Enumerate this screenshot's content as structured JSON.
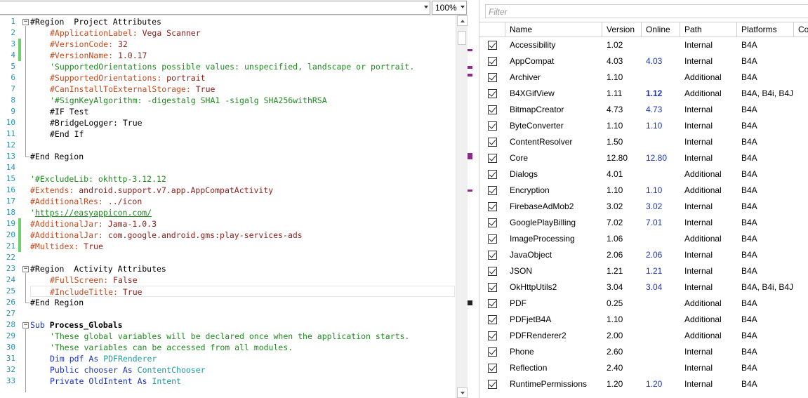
{
  "editor": {
    "module_selector": "",
    "zoom": "100%",
    "lines": [
      {
        "n": "1",
        "seg": [
          [
            "",
            "#Region  Project Attributes"
          ]
        ],
        "indent": false,
        "fold": "-",
        "changed": false
      },
      {
        "n": "2",
        "seg": [
          [
            "attr",
            "#ApplicationLabel: "
          ],
          [
            "str",
            "Vega Scanner"
          ]
        ],
        "indent": true,
        "changed": false
      },
      {
        "n": "3",
        "seg": [
          [
            "attr",
            "#VersionCode: "
          ],
          [
            "str",
            "32"
          ]
        ],
        "indent": true,
        "changed": true
      },
      {
        "n": "4",
        "seg": [
          [
            "attr",
            "#VersionName: "
          ],
          [
            "str",
            "1.0.17"
          ]
        ],
        "indent": true,
        "changed": true
      },
      {
        "n": "5",
        "seg": [
          [
            "cmt",
            "'SupportedOrientations possible values: unspecified, landscape or portrait."
          ]
        ],
        "indent": true,
        "changed": false
      },
      {
        "n": "6",
        "seg": [
          [
            "attr",
            "#SupportedOrientations: "
          ],
          [
            "str",
            "portrait"
          ]
        ],
        "indent": true,
        "changed": false
      },
      {
        "n": "7",
        "seg": [
          [
            "attr",
            "#CanInstallToExternalStorage: "
          ],
          [
            "str",
            "True"
          ]
        ],
        "indent": true,
        "changed": false
      },
      {
        "n": "8",
        "seg": [
          [
            "cmt",
            "'#SignKeyAlgorithm: -digestalg SHA1 -sigalg SHA256withRSA"
          ]
        ],
        "indent": true,
        "changed": false
      },
      {
        "n": "9",
        "seg": [
          [
            "",
            "#IF Test"
          ]
        ],
        "indent": true,
        "changed": false
      },
      {
        "n": "10",
        "seg": [
          [
            "",
            "#BridgeLogger: True"
          ]
        ],
        "indent": true,
        "changed": false
      },
      {
        "n": "11",
        "seg": [
          [
            "",
            "#End If"
          ]
        ],
        "indent": true,
        "changed": false
      },
      {
        "n": "12",
        "seg": [
          [
            "",
            ""
          ]
        ],
        "indent": false,
        "changed": false
      },
      {
        "n": "13",
        "seg": [
          [
            "",
            "#End Region"
          ]
        ],
        "indent": false,
        "changed": false
      },
      {
        "n": "14",
        "seg": [
          [
            "",
            ""
          ]
        ],
        "indent": false,
        "changed": false
      },
      {
        "n": "15",
        "seg": [
          [
            "cmt",
            "'#ExcludeLib: okhttp-3.12.12"
          ]
        ],
        "indent": false,
        "changed": false
      },
      {
        "n": "16",
        "seg": [
          [
            "attr",
            "#Extends: "
          ],
          [
            "str",
            "android.support.v7.app.AppCompatActivity"
          ]
        ],
        "indent": false,
        "changed": false
      },
      {
        "n": "17",
        "seg": [
          [
            "attr",
            "#AdditionalRes: "
          ],
          [
            "str",
            "../icon"
          ]
        ],
        "indent": false,
        "changed": false
      },
      {
        "n": "18",
        "seg": [
          [
            "cmt",
            "'"
          ],
          [
            "link",
            "https://easyappicon.com/"
          ]
        ],
        "indent": false,
        "changed": false
      },
      {
        "n": "19",
        "seg": [
          [
            "attr",
            "#AdditionalJar: "
          ],
          [
            "str",
            "Jama-1.0.3"
          ]
        ],
        "indent": false,
        "changed": true
      },
      {
        "n": "20",
        "seg": [
          [
            "attr",
            "#AdditionalJar: "
          ],
          [
            "str",
            "com.google.android.gms:play-services-ads"
          ]
        ],
        "indent": false,
        "changed": true
      },
      {
        "n": "21",
        "seg": [
          [
            "attr",
            "#Multidex: "
          ],
          [
            "str",
            "True"
          ]
        ],
        "indent": false,
        "changed": true
      },
      {
        "n": "22",
        "seg": [
          [
            "",
            ""
          ]
        ],
        "indent": false,
        "changed": false
      },
      {
        "n": "23",
        "seg": [
          [
            "",
            "#Region  Activity Attributes"
          ]
        ],
        "indent": false,
        "fold": "-",
        "changed": false
      },
      {
        "n": "24",
        "seg": [
          [
            "attr",
            "#FullScreen: "
          ],
          [
            "str",
            "False"
          ]
        ],
        "indent": true,
        "changed": false
      },
      {
        "n": "25",
        "seg": [
          [
            "attr",
            "#IncludeTitle: "
          ],
          [
            "str",
            "True"
          ]
        ],
        "indent": true,
        "changed": false,
        "current": true
      },
      {
        "n": "26",
        "seg": [
          [
            "",
            "#End Region"
          ]
        ],
        "indent": false,
        "changed": false
      },
      {
        "n": "27",
        "seg": [
          [
            "",
            ""
          ]
        ],
        "indent": false,
        "changed": false
      },
      {
        "n": "28",
        "seg": [
          [
            "kw",
            "Sub "
          ],
          [
            "bold",
            "Process_Globals"
          ]
        ],
        "indent": false,
        "fold": "-",
        "changed": false
      },
      {
        "n": "29",
        "seg": [
          [
            "cmt",
            "'These global variables will be declared once when the application starts."
          ]
        ],
        "indent": true,
        "changed": false
      },
      {
        "n": "30",
        "seg": [
          [
            "cmt",
            "'These variables can be accessed from all modules."
          ]
        ],
        "indent": true,
        "changed": false
      },
      {
        "n": "31",
        "seg": [
          [
            "kw",
            "Dim "
          ],
          [
            "kw",
            "pdf "
          ],
          [
            "kw",
            "As "
          ],
          [
            "typ",
            "PDFRenderer"
          ]
        ],
        "indent": true,
        "changed": false
      },
      {
        "n": "32",
        "seg": [
          [
            "kw",
            "Public "
          ],
          [
            "kw",
            "chooser "
          ],
          [
            "kw",
            "As "
          ],
          [
            "typ",
            "ContentChooser"
          ]
        ],
        "indent": true,
        "changed": false
      },
      {
        "n": "33",
        "seg": [
          [
            "kw",
            "Private "
          ],
          [
            "kw",
            "OldIntent "
          ],
          [
            "kw",
            "As "
          ],
          [
            "typ",
            "Intent"
          ]
        ],
        "indent": true,
        "changed": false
      }
    ]
  },
  "libraries": {
    "filter_placeholder": "Filter",
    "columns": [
      "Name",
      "Version",
      "Online",
      "Path",
      "Platforms",
      "Co"
    ],
    "rows": [
      {
        "name": "Accessibility",
        "version": "1.02",
        "online": "",
        "online_new": false,
        "path": "Internal",
        "platforms": "B4A"
      },
      {
        "name": "AppCompat",
        "version": "4.03",
        "online": "4.03",
        "online_new": false,
        "path": "Internal",
        "platforms": "B4A"
      },
      {
        "name": "Archiver",
        "version": "1.10",
        "online": "",
        "online_new": false,
        "path": "Additional",
        "platforms": "B4A"
      },
      {
        "name": "B4XGifView",
        "version": "1.11",
        "online": "1.12",
        "online_new": true,
        "path": "Additional",
        "platforms": "B4A, B4i, B4J"
      },
      {
        "name": "BitmapCreator",
        "version": "4.73",
        "online": "4.73",
        "online_new": false,
        "path": "Internal",
        "platforms": "B4A"
      },
      {
        "name": "ByteConverter",
        "version": "1.10",
        "online": "1.10",
        "online_new": false,
        "path": "Internal",
        "platforms": "B4A"
      },
      {
        "name": "ContentResolver",
        "version": "1.50",
        "online": "",
        "online_new": false,
        "path": "Internal",
        "platforms": "B4A"
      },
      {
        "name": "Core",
        "version": "12.80",
        "online": "12.80",
        "online_new": false,
        "path": "Internal",
        "platforms": "B4A"
      },
      {
        "name": "Dialogs",
        "version": "4.01",
        "online": "",
        "online_new": false,
        "path": "Additional",
        "platforms": "B4A"
      },
      {
        "name": "Encryption",
        "version": "1.10",
        "online": "1.10",
        "online_new": false,
        "path": "Additional",
        "platforms": "B4A"
      },
      {
        "name": "FirebaseAdMob2",
        "version": "3.02",
        "online": "3.02",
        "online_new": false,
        "path": "Internal",
        "platforms": "B4A"
      },
      {
        "name": "GooglePlayBilling",
        "version": "7.02",
        "online": "7.01",
        "online_new": false,
        "path": "Internal",
        "platforms": "B4A"
      },
      {
        "name": "ImageProcessing",
        "version": "1.06",
        "online": "",
        "online_new": false,
        "path": "Additional",
        "platforms": "B4A"
      },
      {
        "name": "JavaObject",
        "version": "2.06",
        "online": "2.06",
        "online_new": false,
        "path": "Internal",
        "platforms": "B4A"
      },
      {
        "name": "JSON",
        "version": "1.21",
        "online": "1.21",
        "online_new": false,
        "path": "Internal",
        "platforms": "B4A"
      },
      {
        "name": "OkHttpUtils2",
        "version": "3.04",
        "online": "3.04",
        "online_new": false,
        "path": "Internal",
        "platforms": "B4A, B4i, B4J"
      },
      {
        "name": "PDF",
        "version": "0.25",
        "online": "",
        "online_new": false,
        "path": "Additional",
        "platforms": "B4A"
      },
      {
        "name": "PDFjetB4A",
        "version": "1.10",
        "online": "",
        "online_new": false,
        "path": "Additional",
        "platforms": "B4A"
      },
      {
        "name": "PDFRenderer2",
        "version": "2.00",
        "online": "",
        "online_new": false,
        "path": "Additional",
        "platforms": "B4A"
      },
      {
        "name": "Phone",
        "version": "2.60",
        "online": "",
        "online_new": false,
        "path": "Internal",
        "platforms": "B4A"
      },
      {
        "name": "Reflection",
        "version": "2.40",
        "online": "",
        "online_new": false,
        "path": "Internal",
        "platforms": "B4A"
      },
      {
        "name": "RuntimePermissions",
        "version": "1.20",
        "online": "1.20",
        "online_new": false,
        "path": "Internal",
        "platforms": "B4A"
      }
    ]
  },
  "colors": {
    "line_number": "#2b91af",
    "attribute": "#c94a1e",
    "string": "#8b1f1a",
    "comment": "#1f8a1f",
    "keyword": "#1a34c8",
    "change_bar": "#6fcf6f",
    "marker": "#8a2a8a",
    "online_version": "#1a34c8"
  }
}
